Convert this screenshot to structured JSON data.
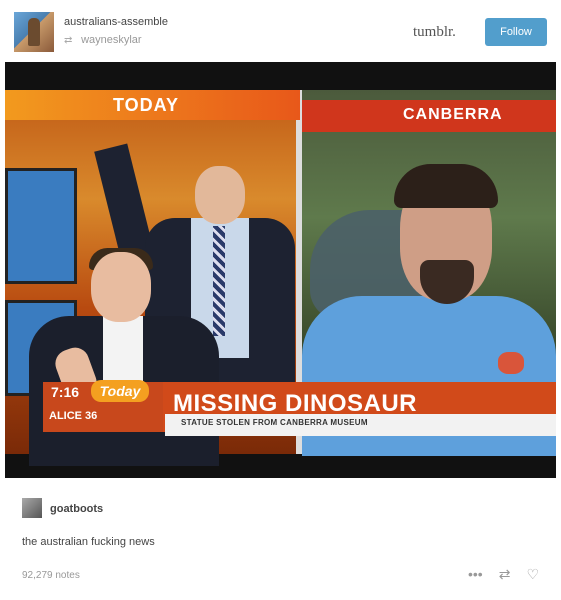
{
  "header": {
    "username": "australians-assemble",
    "reblogged_from": "wayneskylar",
    "logo_text": "tumblr.",
    "follow_label": "Follow"
  },
  "broadcast": {
    "left_label": "TODAY",
    "right_label": "CANBERRA",
    "time": "7:16",
    "logo": "Today",
    "alice": "ALICE  36",
    "headline": "MISSING DINOSAUR",
    "subheadline": "STATUE STOLEN FROM CANBERRA MUSEUM"
  },
  "post": {
    "commenter": "goatboots",
    "comment": "the australian fucking news",
    "notes": "92,279 notes"
  },
  "icons": [
    "avatar",
    "reblog-icon",
    "more-icon",
    "reblog-action-icon",
    "like-icon"
  ]
}
